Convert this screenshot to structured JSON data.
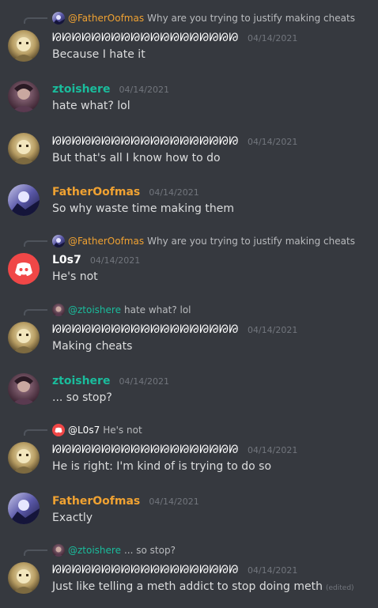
{
  "theme": {
    "background": "#36393f",
    "ztoishere_color": "#1abc9c",
    "fatheroofmas_color": "#f0a232",
    "discord_blurple": "#f04747"
  },
  "messages": [
    {
      "reply": {
        "name": "@FatherOofmas",
        "text": "Why are you trying to justify making cheats"
      },
      "author": "ᘙᘙᘙᘙᘙᘙᘙᘙᘙᘙᘙᘙᘙᘙᘙᘙᘙᘙᘙ",
      "timestamp": "04/14/2021",
      "text": "Because I hate it"
    },
    {
      "author": "ztoishere",
      "timestamp": "04/14/2021",
      "text": "hate what? lol"
    },
    {
      "author": "ᘙᘙᘙᘙᘙᘙᘙᘙᘙᘙᘙᘙᘙᘙᘙᘙᘙᘙᘙ",
      "timestamp": "04/14/2021",
      "text": "But that's all I know how to do"
    },
    {
      "author": "FatherOofmas",
      "timestamp": "04/14/2021",
      "text": "So why waste time making them"
    },
    {
      "reply": {
        "name": "@FatherOofmas",
        "text": "Why are you trying to justify making cheats"
      },
      "author": "L0s7",
      "timestamp": "04/14/2021",
      "text": "He's not"
    },
    {
      "reply": {
        "name": "@ztoishere",
        "text": "hate what? lol"
      },
      "author": "ᘙᘙᘙᘙᘙᘙᘙᘙᘙᘙᘙᘙᘙᘙᘙᘙᘙᘙᘙ",
      "timestamp": "04/14/2021",
      "text": "Making cheats"
    },
    {
      "author": "ztoishere",
      "timestamp": "04/14/2021",
      "text": "... so stop?"
    },
    {
      "reply": {
        "name": "@L0s7",
        "text": "He's not"
      },
      "author": "ᘙᘙᘙᘙᘙᘙᘙᘙᘙᘙᘙᘙᘙᘙᘙᘙᘙᘙᘙ",
      "timestamp": "04/14/2021",
      "text": "He is right: I'm kind of is trying to do so"
    },
    {
      "author": "FatherOofmas",
      "timestamp": "04/14/2021",
      "text": "Exactly"
    },
    {
      "reply": {
        "name": "@ztoishere",
        "text": "... so stop?"
      },
      "author": "ᘙᘙᘙᘙᘙᘙᘙᘙᘙᘙᘙᘙᘙᘙᘙᘙᘙᘙᘙ",
      "timestamp": "04/14/2021",
      "text": "Just like telling a meth addict to stop doing meth",
      "edited": "(edited)"
    }
  ]
}
